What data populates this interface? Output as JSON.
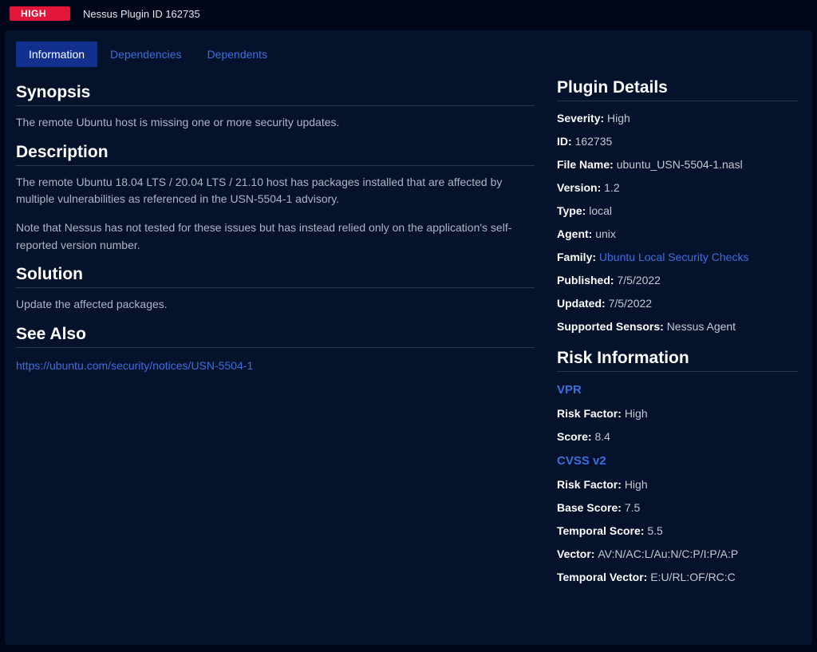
{
  "header": {
    "severity_badge": "HIGH",
    "plugin_id_label": "Nessus Plugin ID 162735"
  },
  "tabs": [
    {
      "label": "Information",
      "active": true
    },
    {
      "label": "Dependencies",
      "active": false
    },
    {
      "label": "Dependents",
      "active": false
    }
  ],
  "main": {
    "synopsis_h": "Synopsis",
    "synopsis": "The remote Ubuntu host is missing one or more security updates.",
    "description_h": "Description",
    "description_p1": "The remote Ubuntu 18.04 LTS / 20.04 LTS / 21.10 host has packages installed that are affected by multiple vulnerabilities as referenced in the USN-5504-1 advisory.",
    "description_p2": "Note that Nessus has not tested for these issues but has instead relied only on the application's self-reported version number.",
    "solution_h": "Solution",
    "solution": "Update the affected packages.",
    "seealso_h": "See Also",
    "seealso_link": "https://ubuntu.com/security/notices/USN-5504-1"
  },
  "details": {
    "heading": "Plugin Details",
    "rows": [
      {
        "k": "Severity:",
        "v": "High",
        "link": false
      },
      {
        "k": "ID:",
        "v": "162735",
        "link": false
      },
      {
        "k": "File Name:",
        "v": "ubuntu_USN-5504-1.nasl",
        "link": false
      },
      {
        "k": "Version:",
        "v": "1.2",
        "link": false
      },
      {
        "k": "Type:",
        "v": "local",
        "link": false
      },
      {
        "k": "Agent:",
        "v": "unix",
        "link": false
      },
      {
        "k": "Family:",
        "v": "Ubuntu Local Security Checks",
        "link": true
      },
      {
        "k": "Published:",
        "v": "7/5/2022",
        "link": false
      },
      {
        "k": "Updated:",
        "v": "7/5/2022",
        "link": false
      },
      {
        "k": "Supported Sensors:",
        "v": "Nessus Agent",
        "link": false
      }
    ]
  },
  "risk": {
    "heading": "Risk Information",
    "vpr_label": "VPR",
    "vpr_rows": [
      {
        "k": "Risk Factor:",
        "v": "High"
      },
      {
        "k": "Score:",
        "v": "8.4"
      }
    ],
    "cvss2_label": "CVSS v2",
    "cvss2_rows": [
      {
        "k": "Risk Factor:",
        "v": "High"
      },
      {
        "k": "Base Score:",
        "v": "7.5"
      },
      {
        "k": "Temporal Score:",
        "v": "5.5"
      },
      {
        "k": "Vector:",
        "v": "AV:N/AC:L/Au:N/C:P/I:P/A:P"
      },
      {
        "k": "Temporal Vector:",
        "v": "E:U/RL:OF/RC:C"
      }
    ]
  }
}
